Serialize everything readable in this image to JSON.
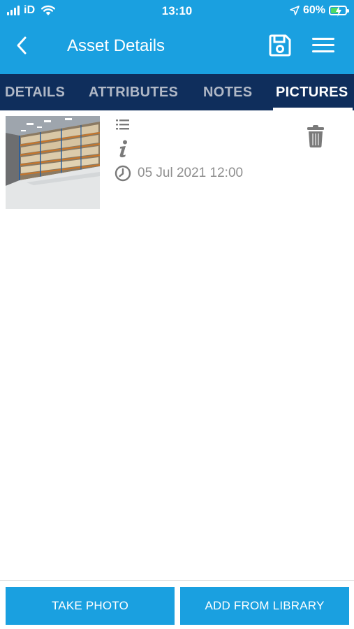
{
  "status_bar": {
    "carrier": "iD",
    "time": "13:10",
    "battery_percent": "60%",
    "battery_level": 0.6,
    "icons": [
      "signal-icon",
      "wifi-icon",
      "location-arrow-icon",
      "battery-charging-icon"
    ]
  },
  "header": {
    "title": "Asset Details",
    "icons": [
      "back-chevron-icon",
      "save-floppy-icon",
      "hamburger-menu-icon"
    ]
  },
  "tabs": [
    {
      "label": "DETAILS",
      "active": false
    },
    {
      "label": "ATTRIBUTES",
      "active": false
    },
    {
      "label": "NOTES",
      "active": false
    },
    {
      "label": "PICTURES",
      "active": true
    }
  ],
  "pictures": [
    {
      "thumbnail": "warehouse-photo",
      "datetime": "05 Jul 2021 12:00",
      "icons": [
        "list-icon",
        "info-icon",
        "clock-icon",
        "trash-icon"
      ]
    }
  ],
  "actions": {
    "take_photo": "TAKE PHOTO",
    "add_from_library": "ADD FROM LIBRARY"
  },
  "colors": {
    "primary": "#1aa0e0",
    "tab_bar": "#0f2e5c",
    "tab_inactive_text": "#b0b8c6",
    "meta_text": "#8f8f8f",
    "icon_gray": "#7a7a7a"
  }
}
